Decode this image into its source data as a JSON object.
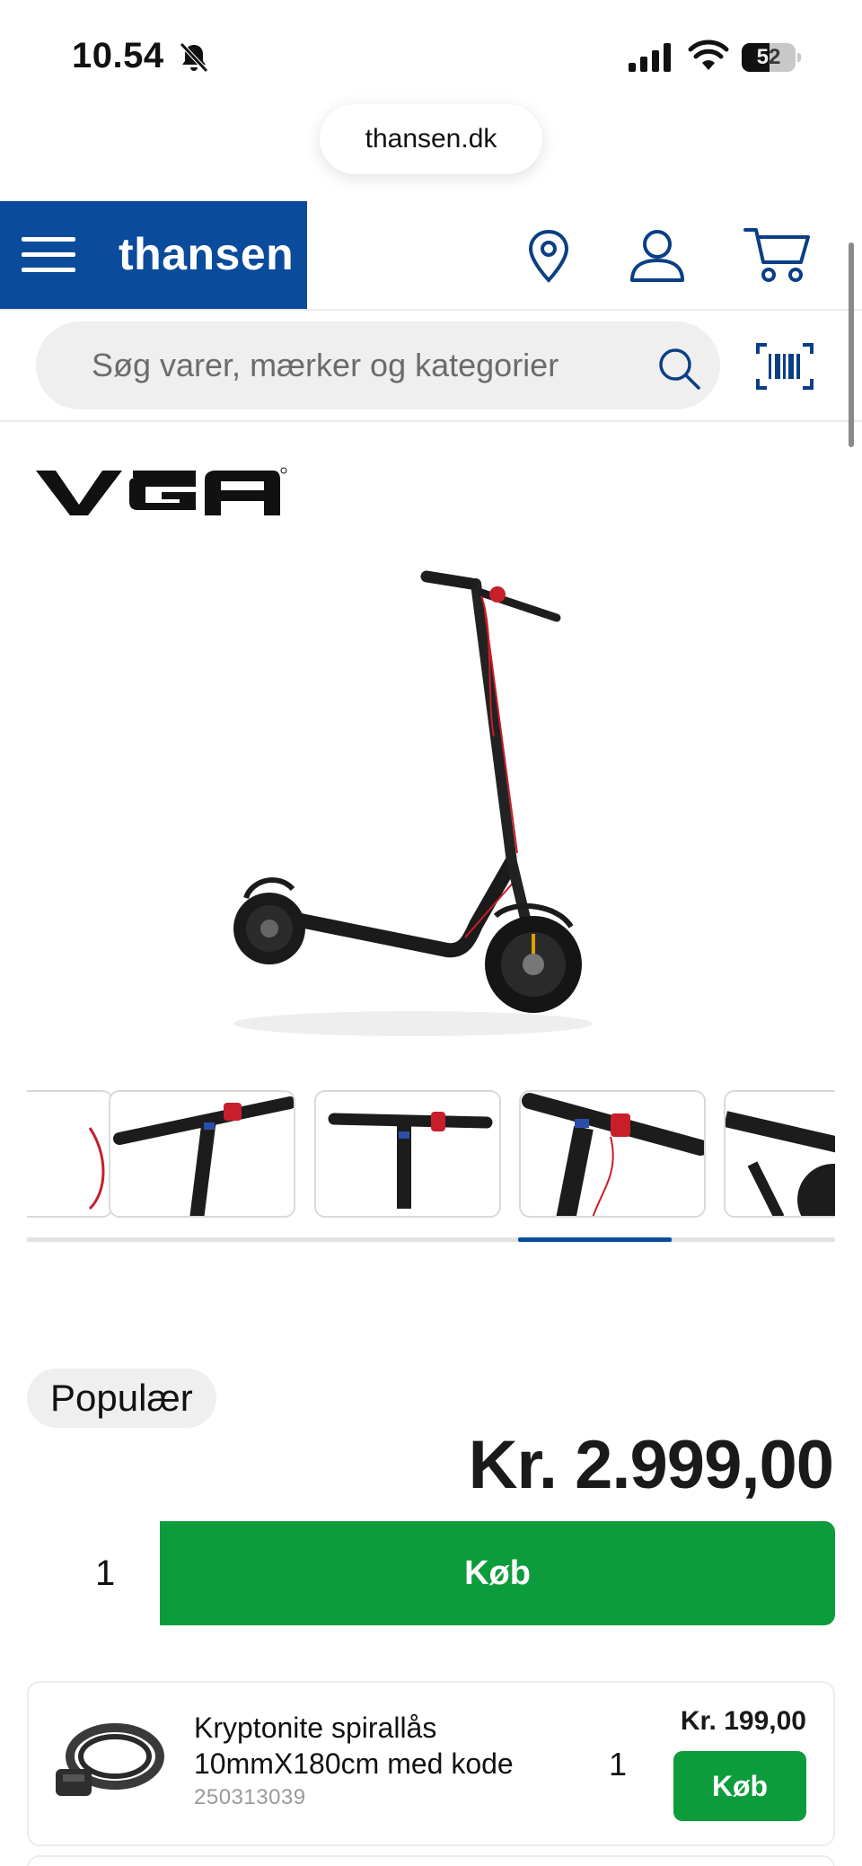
{
  "status_bar": {
    "time": "10.54",
    "battery": "52",
    "battery_level": 0.52
  },
  "browser": {
    "url": "thansen.dk"
  },
  "header": {
    "logo": "thansen",
    "brand_color": "#0a4b9b",
    "icons": [
      "menu-icon",
      "location-icon",
      "account-icon",
      "cart-icon"
    ]
  },
  "search": {
    "placeholder": "Søg varer, mærker og kategorier",
    "icons": [
      "search-icon",
      "barcode-icon"
    ]
  },
  "product": {
    "brand": "VGA",
    "badge": "Populær",
    "price": "Kr. 2.999,00",
    "quantity": "1",
    "buy_label": "Køb",
    "buy_color": "#0d9c3c",
    "gallery": {
      "thumbnail_count_visible": 5,
      "scroll_position": 0.75,
      "scroll_fraction_visible": 0.19
    }
  },
  "accessory": {
    "name": "Kryptonite spirallås 10mmX180cm med kode",
    "sku": "250313039",
    "price": "Kr. 199,00",
    "quantity": "1",
    "buy_label": "Køb"
  }
}
